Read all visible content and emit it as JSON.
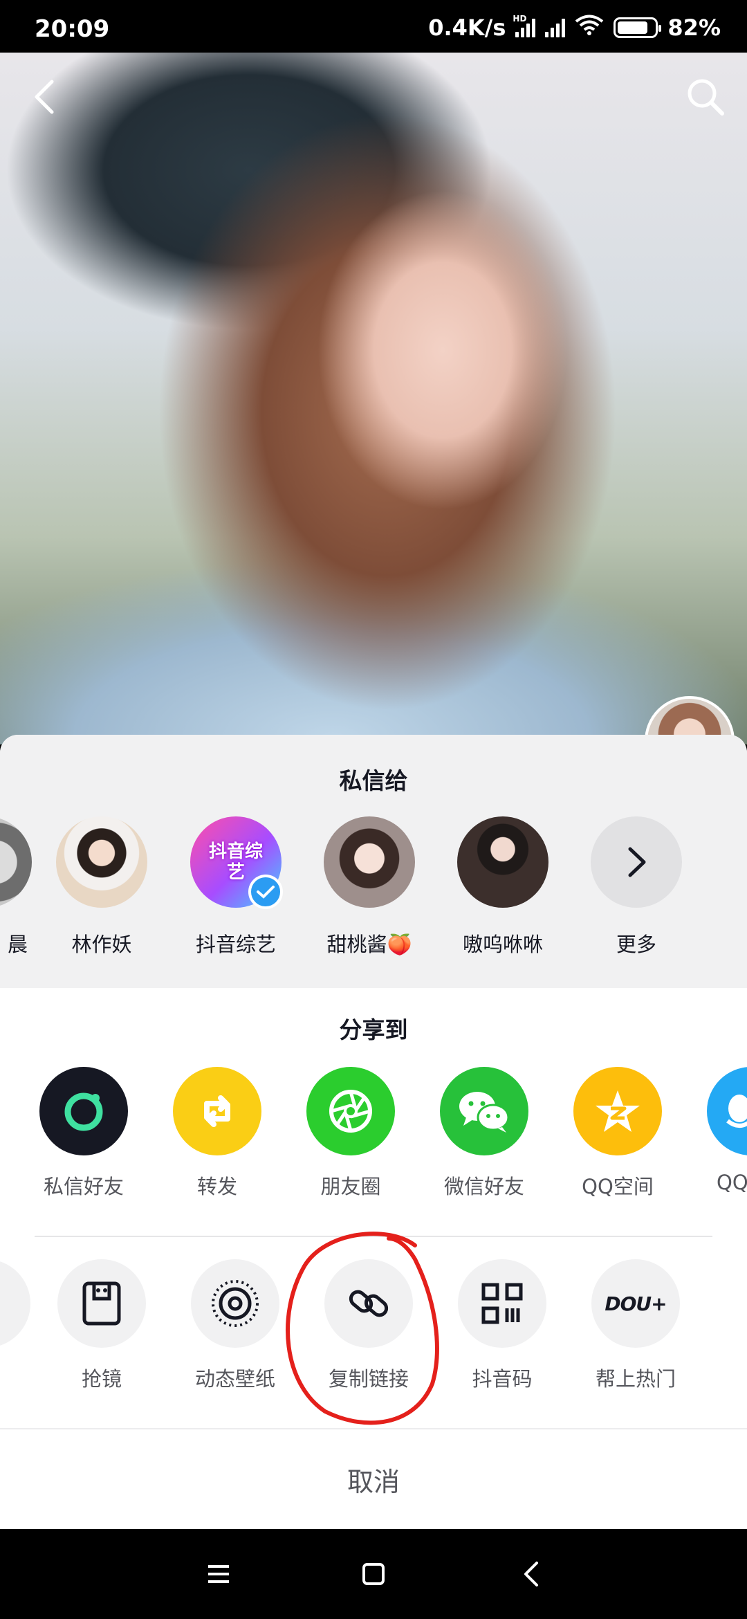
{
  "status_bar": {
    "time": "20:09",
    "net_speed": "0.4K/s",
    "hd_badge": "HD",
    "battery": "82%",
    "battery_level": 0.82
  },
  "video": {
    "back_icon": "chevron-left-icon",
    "search_icon": "search-icon"
  },
  "dm_section": {
    "title": "私信给",
    "contacts": [
      {
        "name": "晨",
        "partial": true
      },
      {
        "name": "林作妖"
      },
      {
        "name": "抖音综艺",
        "verified": true,
        "badge_text": "抖音综艺"
      },
      {
        "name": "甜桃酱🍑"
      },
      {
        "name": "嗷呜咻咻"
      },
      {
        "name": "更多",
        "icon": "chevron-right-icon"
      }
    ]
  },
  "share_section": {
    "title": "分享到",
    "items": [
      {
        "label": "私信好友",
        "icon": "private-message-icon",
        "color": "#161823"
      },
      {
        "label": "转发",
        "icon": "repost-icon",
        "color": "#FACE15"
      },
      {
        "label": "朋友圈",
        "icon": "moments-icon",
        "color": "#2BCD2E"
      },
      {
        "label": "微信好友",
        "icon": "wechat-icon",
        "color": "#27C13A"
      },
      {
        "label": "QQ空间",
        "icon": "qzone-icon",
        "color": "#FDBE0C"
      },
      {
        "label": "QQ",
        "icon": "qq-icon",
        "color": "#24A9F4",
        "partial": true
      }
    ]
  },
  "tools_section": {
    "items": [
      {
        "label": "抢镜",
        "icon": "duet-icon"
      },
      {
        "label": "动态壁纸",
        "icon": "live-wallpaper-icon"
      },
      {
        "label": "复制链接",
        "icon": "link-icon"
      },
      {
        "label": "抖音码",
        "icon": "qr-code-icon"
      },
      {
        "label": "帮上热门",
        "icon": "dou-plus-icon",
        "icon_text": "DOU+"
      }
    ]
  },
  "cancel_label": "取消",
  "annotation": {
    "color": "#E4201B",
    "target": "复制链接"
  },
  "nav_bar": {
    "menu_icon": "menu-icon",
    "home_icon": "home-icon",
    "back_icon": "back-triangle-icon"
  }
}
